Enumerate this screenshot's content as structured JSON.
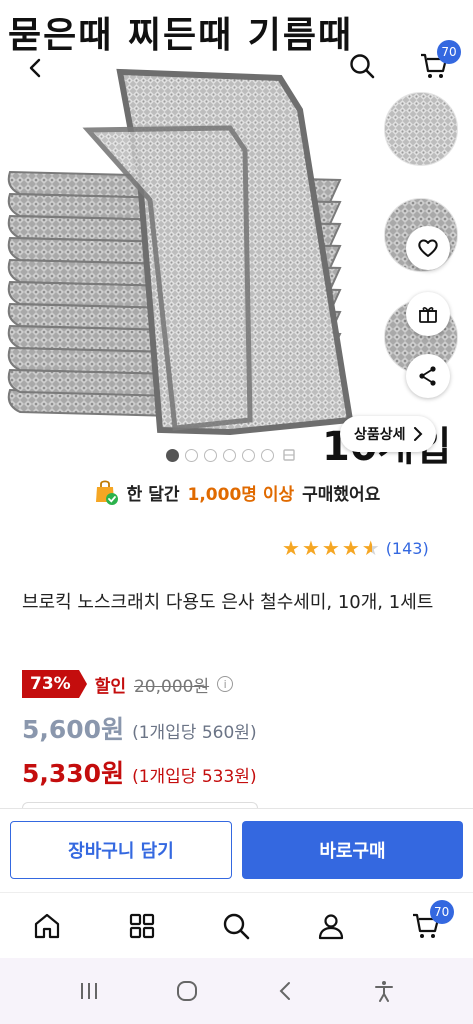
{
  "hero": {
    "banner_text": "묻은때 찌든때 기름때",
    "overlay_count": "10개입",
    "detail_button_label": "상품상세",
    "page_indicator": {
      "total": 6,
      "active": 1
    }
  },
  "header": {
    "cart_badge": "70"
  },
  "info": {
    "buyers_prefix": "한 달간",
    "buyers_highlight": "1,000명 이상",
    "buyers_suffix": "구매했어요",
    "rating_stars": 4.5,
    "rating_count": "(143)",
    "title": "브로킥 노스크래치 다용도 은사 철수세미, 10개, 1세트"
  },
  "pricing": {
    "discount_pct": "73%",
    "sale_label": "할인",
    "original_price": "20,000원",
    "price": "5,600원",
    "unit_price": "(1개입당 560원)",
    "coupon_price": "5,330원",
    "coupon_unit_price": "(1개입당 533원)"
  },
  "actions": {
    "add_to_cart": "장바구니 담기",
    "buy_now": "바로구매"
  },
  "tab_bar": {
    "cart_badge": "70"
  },
  "colors": {
    "accent_blue": "#3468e0",
    "sale_red": "#c40d0d",
    "star_orange": "#f5a623",
    "highlight_orange": "#e06a00"
  }
}
